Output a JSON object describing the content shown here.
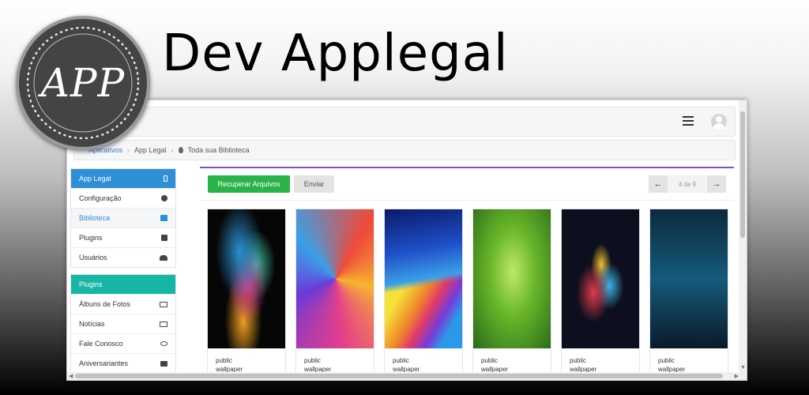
{
  "banner": {
    "title": "Dev Applegal",
    "logo_text": "APP"
  },
  "topbar": {
    "menu_icon": "hamburger-icon",
    "avatar_icon": "user-avatar-icon"
  },
  "breadcrumb": {
    "items": [
      "Aplicativos",
      "App Legal",
      "Toda sua Biblioteca"
    ]
  },
  "sidebar": {
    "group1": {
      "title": "App Legal",
      "items": [
        {
          "label": "Configuração",
          "icon": "gear-icon"
        },
        {
          "label": "Biblioteca",
          "icon": "book-icon",
          "active": true
        },
        {
          "label": "Plugins",
          "icon": "puzzle-icon"
        },
        {
          "label": "Usuários",
          "icon": "users-icon"
        }
      ]
    },
    "group2": {
      "title": "Plugins",
      "items": [
        {
          "label": "Álbuns de Fotos",
          "icon": "image-icon"
        },
        {
          "label": "Notícias",
          "icon": "newspaper-icon"
        },
        {
          "label": "Fale Conosco",
          "icon": "chat-icon"
        },
        {
          "label": "Aniversariantes",
          "icon": "cake-icon"
        }
      ]
    }
  },
  "toolbar": {
    "recover_label": "Recuperar Arquivos",
    "send_label": "Enviar"
  },
  "pager": {
    "info": "4 de 9",
    "prev_icon": "arrow-left-icon",
    "next_icon": "arrow-right-icon"
  },
  "cards": [
    {
      "line1": "public",
      "line2": "wallpaper"
    },
    {
      "line1": "public",
      "line2": "wallpaper"
    },
    {
      "line1": "public",
      "line2": "wallpaper"
    },
    {
      "line1": "public",
      "line2": "wallpaper"
    },
    {
      "line1": "public",
      "line2": "wallpaper"
    },
    {
      "line1": "public",
      "line2": "wallpaper"
    }
  ],
  "colors": {
    "accent_blue": "#2f8fd6",
    "accent_teal": "#16b6a6",
    "accent_green": "#2bb34b",
    "panel_top": "#7b52c9"
  }
}
